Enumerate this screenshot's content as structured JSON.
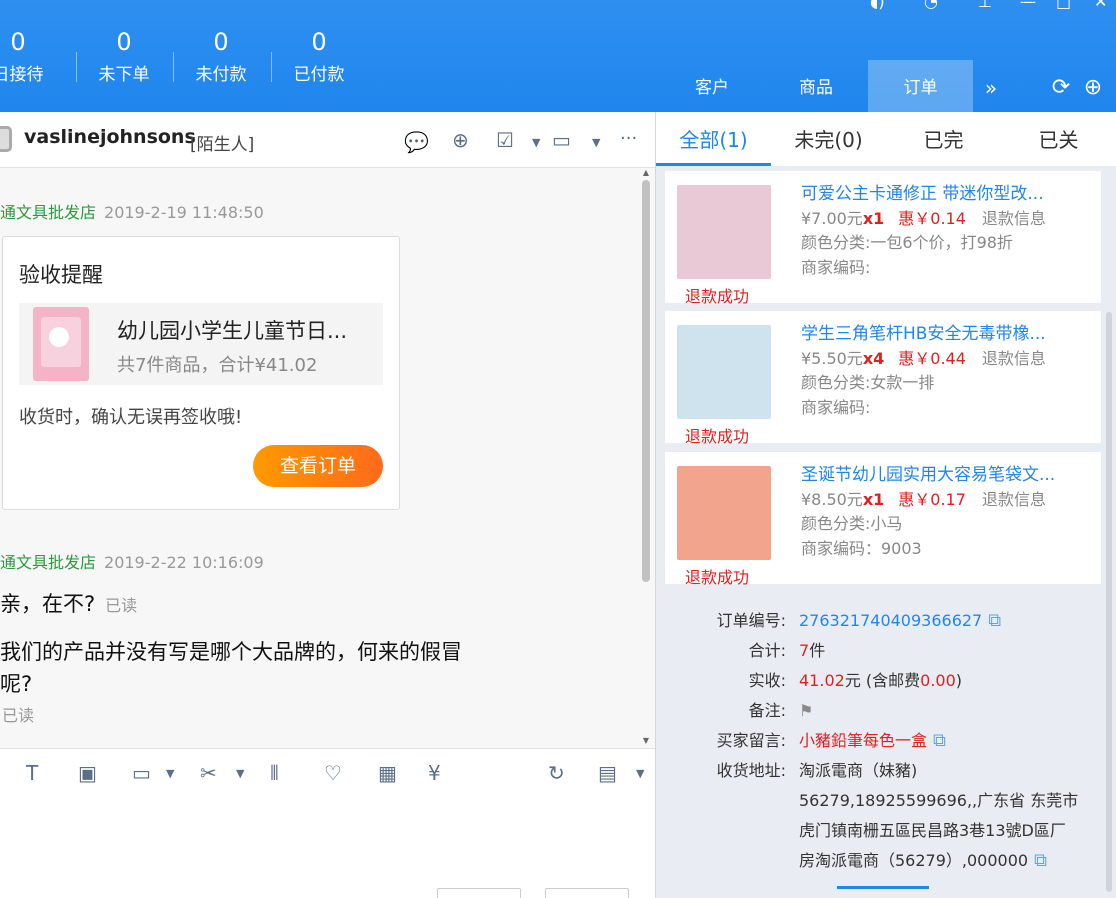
{
  "header": {
    "stats": [
      {
        "value": "0",
        "label": "日接待"
      },
      {
        "value": "0",
        "label": "未下单"
      },
      {
        "value": "0",
        "label": "未付款"
      },
      {
        "value": "0",
        "label": "已付款"
      }
    ],
    "tabs": [
      {
        "label": "客户"
      },
      {
        "label": "商品"
      },
      {
        "label": "订单"
      }
    ],
    "more_icon": "double-chevron-right-icon",
    "refresh_icon": "refresh-icon",
    "add_icon": "plus-circle-icon"
  },
  "chat": {
    "contact_name": "vaslinejohnsons",
    "contact_tag": "[陌生人]",
    "messages": [
      {
        "sender": "通文具批发店",
        "time": "2019-2-19 11:48:50"
      },
      {
        "sender": "通文具批发店",
        "time": "2019-2-22 10:16:09"
      }
    ],
    "card": {
      "title": "验收提醒",
      "item_name": "幼儿园小学生儿童节日...",
      "item_summary": "共7件商品，合计¥41.02",
      "note": "收货时，确认无误再签收哦!",
      "button": "查看订单"
    },
    "msg1": {
      "text": "亲，在不?",
      "status": "已读"
    },
    "msg2": {
      "line1": "我们的产品并没有写是哪个大品牌的，何来的假冒",
      "line2": "呢?",
      "status": "已读"
    }
  },
  "order_tabs": [
    {
      "label": "全部(1)"
    },
    {
      "label": "未完(0)"
    },
    {
      "label": "已完"
    },
    {
      "label": "已关"
    }
  ],
  "items": [
    {
      "name": "可爱公主卡通修正 带迷你型改...",
      "price": "¥7.00元",
      "qty": "x1",
      "discount": "惠￥0.14",
      "refund_info": "退款信息",
      "variant": "颜色分类:一包6个价，打98折",
      "code": "商家编码:",
      "status": "退款成功",
      "thumb_color": "#e9c9d6"
    },
    {
      "name": "学生三角笔杆HB安全无毒带橡...",
      "price": "¥5.50元",
      "qty": "x4",
      "discount": "惠￥0.44",
      "refund_info": "退款信息",
      "variant": "颜色分类:女款一排",
      "code": "商家编码:",
      "status": "退款成功",
      "thumb_color": "#cfe3ef"
    },
    {
      "name": "圣诞节幼儿园实用大容易笔袋文...",
      "price": "¥8.50元",
      "qty": "x1",
      "discount": "惠￥0.17",
      "refund_info": "退款信息",
      "variant": "颜色分类:小马",
      "code": "商家编码：9003",
      "status": "退款成功",
      "thumb_color": "#f2a58c"
    }
  ],
  "order_info": {
    "order_no_label": "订单编号:",
    "order_no": "276321740409366627",
    "total_label": "合计:",
    "total_count": "7",
    "total_unit": "件",
    "paid_label": "实收:",
    "paid_amount": "41.02",
    "paid_unit": "元 (含邮费",
    "shipping": "0.00",
    "paid_close": ")",
    "remark_label": "备注:",
    "buyer_msg_label": "买家留言:",
    "buyer_msg": "小豬鉛筆每色一盒",
    "address_label": "收货地址:",
    "address_lines": [
      "淘派電商（妹豬)",
      "56279,18925599696,,广东省 东莞市",
      "虎门镇南栅五區民昌路3巷13號D區厂",
      "房淘派電商（56279）,000000"
    ]
  }
}
